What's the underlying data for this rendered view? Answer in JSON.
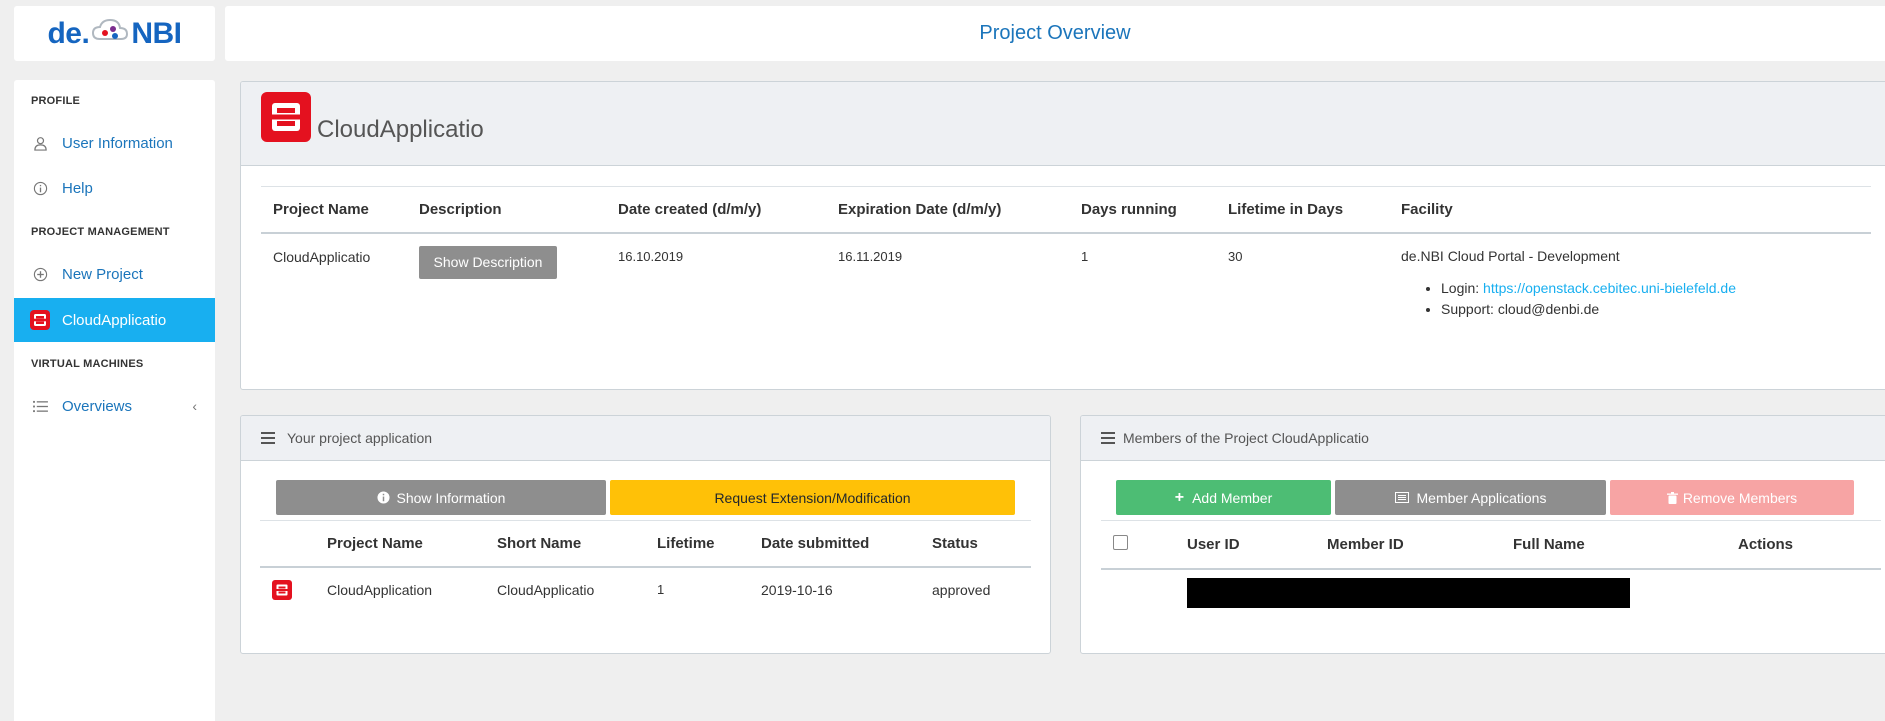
{
  "header": {
    "logo_left": "de.",
    "logo_right": "NBI",
    "title": "Project Overview"
  },
  "sidebar": {
    "sections": [
      {
        "label": "PROFILE"
      },
      {
        "label": "PROJECT MANAGEMENT"
      },
      {
        "label": "VIRTUAL MACHINES"
      }
    ],
    "items": [
      {
        "label": "User Information",
        "icon": "user-icon"
      },
      {
        "label": "Help",
        "icon": "info-icon"
      },
      {
        "label": "New Project",
        "icon": "plus-circle-icon"
      },
      {
        "label": "CloudApplicatio",
        "icon": "openstack-icon"
      },
      {
        "label": "Overviews",
        "icon": "list-icon"
      }
    ]
  },
  "project": {
    "title": "CloudApplicatio",
    "columns": [
      "Project Name",
      "Description",
      "Date created (d/m/y)",
      "Expiration Date (d/m/y)",
      "Days running",
      "Lifetime in Days",
      "Facility"
    ],
    "row": {
      "name": "CloudApplicatio",
      "description_button": "Show Description",
      "date_created": "16.10.2019",
      "expiration_date": "16.11.2019",
      "days_running": "1",
      "lifetime": "30",
      "facility": "de.NBI Cloud Portal - Development",
      "login_label": "Login:",
      "login_url": "https://openstack.cebitec.uni-bielefeld.de",
      "support": "Support: cloud@denbi.de"
    }
  },
  "application": {
    "title": "Your project application",
    "show_info_button": "Show Information",
    "request_button": "Request Extension/Modification",
    "columns": [
      "Project Name",
      "Short Name",
      "Lifetime",
      "Date submitted",
      "Status"
    ],
    "row": {
      "project_name": "CloudApplication",
      "short_name": "CloudApplicatio",
      "lifetime": "1",
      "date_submitted": "2019-10-16",
      "status": "approved"
    }
  },
  "members": {
    "title": "Members of the Project CloudApplicatio",
    "add_button": "Add Member",
    "applications_button": "Member Applications",
    "remove_button": "Remove Members",
    "columns": [
      "User ID",
      "Member ID",
      "Full Name",
      "Actions"
    ]
  },
  "colors": {
    "accent": "#18aff0",
    "link": "#1b75bb",
    "openstack_red": "#e4111f",
    "warning": "#ffc107",
    "success": "#4dbd74",
    "danger_light": "#f7a4a4",
    "secondary": "#8e8e8e"
  }
}
